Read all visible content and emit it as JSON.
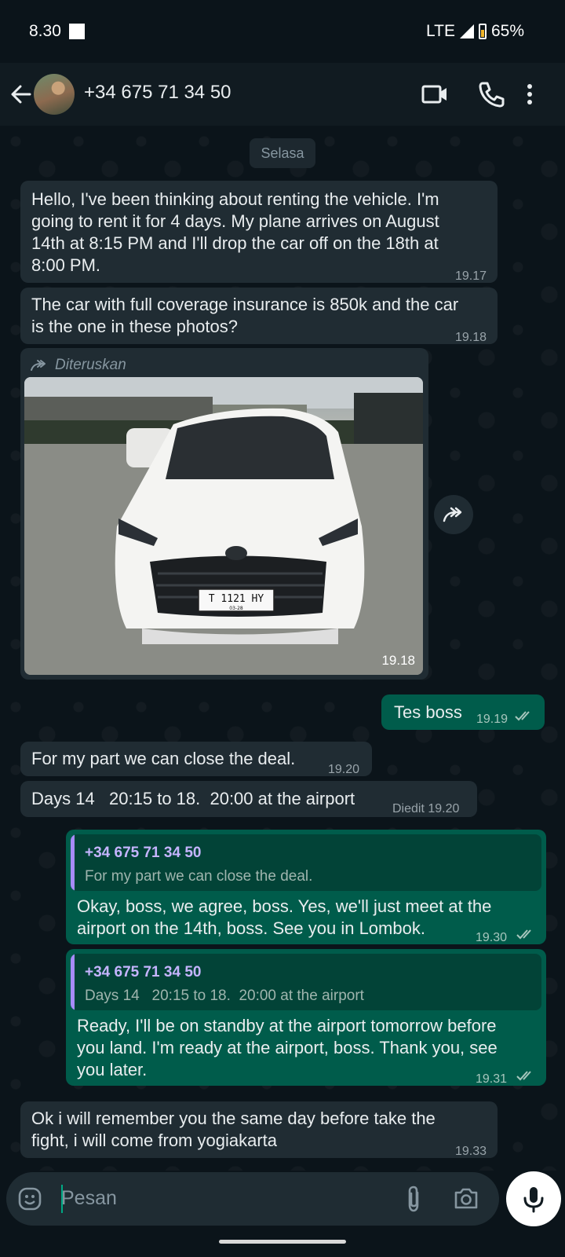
{
  "status_bar": {
    "time": "8.30",
    "network": "LTE",
    "battery": "65%"
  },
  "header": {
    "contact": "+34 675 71 34 50"
  },
  "chat": {
    "day_label": "Selasa",
    "messages": [
      {
        "text_lines": [
          "Hello, I've been thinking about renting the vehicle. I'm",
          "going to rent it for 4 days. My plane arrives on August",
          "14th at 8:15 PM and I'll drop the car off on the 18th at",
          "8:00 PM."
        ],
        "time": "19.17"
      },
      {
        "text_lines": [
          "The car with full coverage insurance is 850k and the car",
          "is the one in these photos?"
        ],
        "time": "19.18"
      },
      {
        "forwarded_label": "Diteruskan",
        "time": "19.18",
        "plate": "T 1121 HY",
        "plate_sub": "03-28"
      },
      {
        "text": "Tes boss",
        "time": "19.19"
      },
      {
        "text": "For my part we can close the deal.",
        "time": "19.20"
      },
      {
        "text": "Days 14   20:15 to 18.  20:00 at the airport",
        "time": "Diedit 19.20"
      },
      {
        "quote_name": "+34 675 71 34 50",
        "quote_text": "For my part we can close the deal.",
        "text_lines": [
          "Okay, boss, we agree, boss. Yes, we'll just meet at the",
          "airport on the 14th, boss. See you in Lombok."
        ],
        "time": "19.30"
      },
      {
        "quote_name": "+34 675 71 34 50",
        "quote_text": "Days 14   20:15 to 18.  20:00 at the airport",
        "text_lines": [
          "Ready, I'll be on standby at the airport tomorrow before",
          "you land. I'm ready at the airport, boss. Thank you, see",
          "you later."
        ],
        "time": "19.31"
      },
      {
        "text_lines": [
          "Ok i will remember you the same day before take the",
          "fight, i will come from yogiakarta"
        ],
        "time": "19.33"
      }
    ]
  },
  "composer": {
    "placeholder": "Pesan"
  },
  "colors": {
    "background": "#0b141a",
    "incoming": "#202c33",
    "outgoing": "#005c4b",
    "accent": "#00a884"
  },
  "icons": [
    "back-arrow-icon",
    "video-call-icon",
    "phone-icon",
    "more-options-icon",
    "forward-icon",
    "emoji-icon",
    "attach-icon",
    "camera-icon",
    "mic-icon",
    "read-ticks-icon"
  ]
}
